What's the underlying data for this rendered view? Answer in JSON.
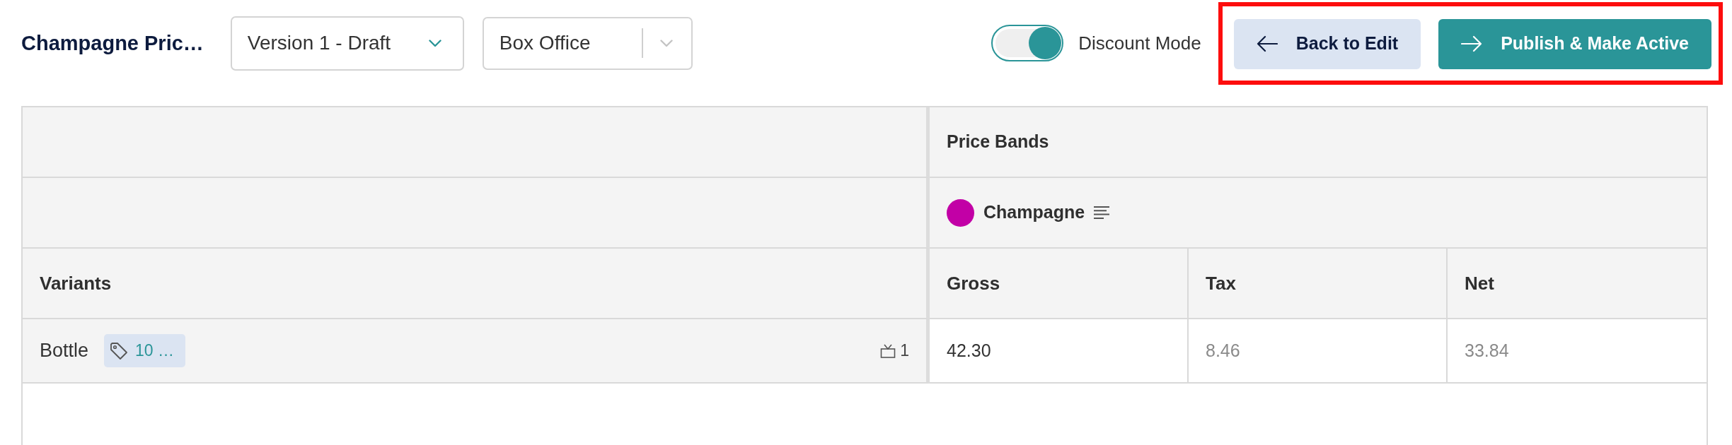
{
  "header": {
    "title": "Champagne Pric…",
    "version_select": {
      "value": "Version 1 - Draft"
    },
    "channel_select": {
      "value": "Box Office"
    },
    "discount_mode": {
      "label": "Discount Mode",
      "on": true
    }
  },
  "actions": {
    "highlighted": true,
    "buttons": [
      {
        "label": "Back to Edit",
        "kind": "secondary"
      },
      {
        "label": "Publish & Make Active",
        "kind": "primary"
      }
    ]
  },
  "table": {
    "group_header": "Price Bands",
    "price_band": {
      "name": "Champagne",
      "color": "#c200a6"
    },
    "columns": [
      "Variants",
      "Gross",
      "Tax",
      "Net"
    ],
    "rows": [
      {
        "cells": [
          {
            "kind": "variant",
            "text": "Bottle",
            "tag": "10 …",
            "count": "1"
          },
          {
            "kind": "value",
            "text": "42.30",
            "editable": true
          },
          {
            "kind": "value",
            "text": "8.46",
            "editable": false
          },
          {
            "kind": "value",
            "text": "33.84",
            "editable": false
          }
        ]
      }
    ]
  }
}
